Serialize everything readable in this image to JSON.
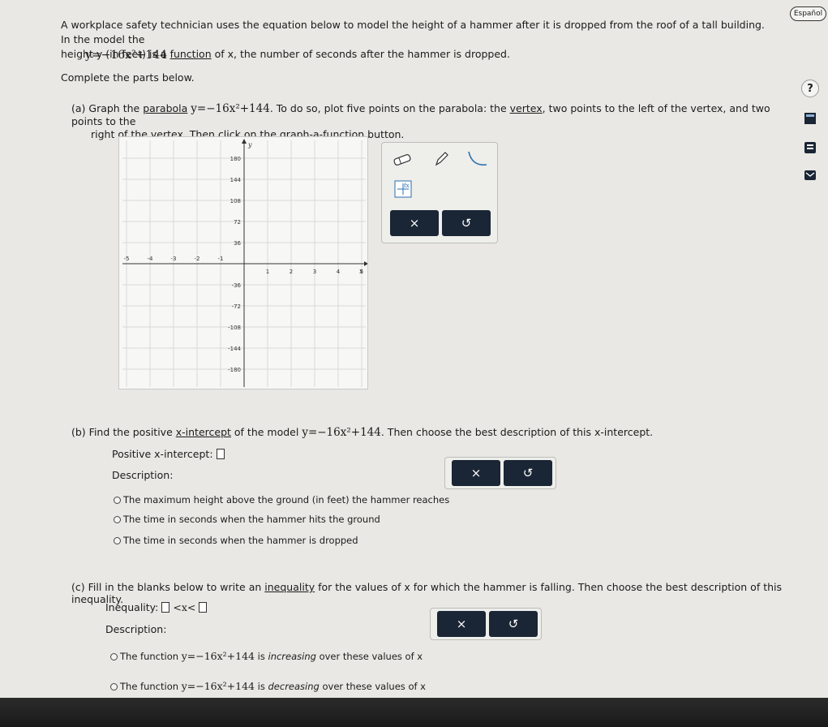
{
  "header": {
    "espanol_label": "Español"
  },
  "problem": {
    "intro_line1": "A workplace safety technician uses the equation below to model the height of a hammer after it is dropped from the roof of a tall building. In the model the",
    "intro_line2_pre": "height y (in feet) is a ",
    "function_link": "function",
    "intro_line2_post": " of x, the number of seconds after the hammer is dropped.",
    "equation": "y=−16x²+144",
    "instructions": "Complete the parts below."
  },
  "part_a": {
    "prefix": "(a) Graph the ",
    "parabola_link": "parabola",
    "equation": "y=−16x²+144",
    "text_mid": ". To do so, plot five points on the parabola: the ",
    "vertex_link": "vertex",
    "text_end": ", two points to the left of the vertex, and two points to the",
    "line2": "right of the vertex. Then click on the graph-a-function button."
  },
  "graph": {
    "x_ticks": [
      "-5",
      "-4",
      "-3",
      "-2",
      "-1",
      "1",
      "2",
      "3",
      "4",
      "5"
    ],
    "y_ticks": [
      "180",
      "144",
      "108",
      "72",
      "36",
      "-36",
      "-72",
      "-108",
      "-144",
      "-180"
    ],
    "y_axis_label": "y",
    "x_axis_label": "x"
  },
  "tools": {
    "eraser_icon": "eraser-icon",
    "pencil_icon": "pencil-icon",
    "curve_icon": "parabola-tool-icon",
    "graph_function_icon": "graph-function-icon",
    "clear_label": "×",
    "undo_label": "↺"
  },
  "part_b": {
    "prefix": "(b) Find the positive ",
    "x_intercept_link": "x-intercept",
    "text_mid": " of the model ",
    "equation": "y=−16x²+144",
    "text_end": ". Then choose the best description of this x-intercept.",
    "answer_label": "Positive x-intercept:",
    "description_label": "Description:",
    "options": [
      "The maximum height above the ground (in feet) the hammer reaches",
      "The time in seconds when the hammer hits the ground",
      "The time in seconds when the hammer is dropped"
    ],
    "clear_label": "×",
    "undo_label": "↺"
  },
  "part_c": {
    "prefix": "(c) Fill in the blanks below to write an ",
    "inequality_link": "inequality",
    "text_end": " for the values of x for which the hammer is falling. Then choose the best description of this inequality.",
    "inequality_label": "Inequality:",
    "inequality_middle": "<x<",
    "description_label": "Description:",
    "option1_pre": "The function ",
    "option1_eq": "y=−16x²+144",
    "option1_post_a": " is ",
    "option1_word": "increasing",
    "option1_post_b": " over these values of x",
    "option2_pre": "The function ",
    "option2_eq": "y=−16x²+144",
    "option2_post_a": " is ",
    "option2_word": "decreasing",
    "option2_post_b": " over these values of x",
    "clear_label": "×",
    "undo_label": "↺"
  },
  "sidebar": {
    "help_label": "?",
    "icons": [
      "calculator-icon",
      "notes-icon",
      "mail-icon"
    ]
  }
}
